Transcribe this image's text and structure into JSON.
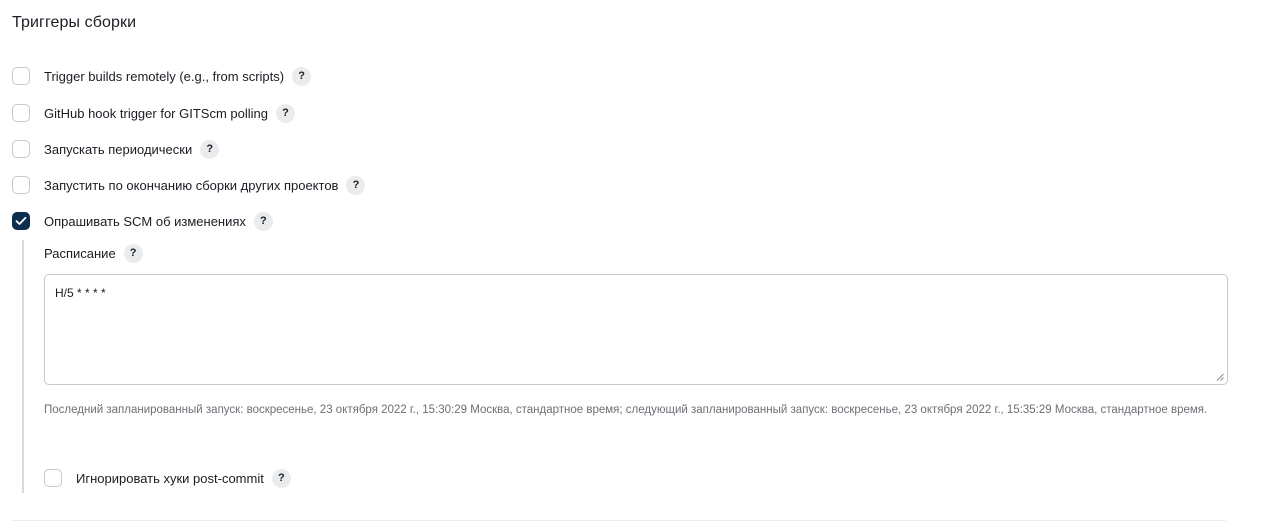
{
  "section": {
    "title": "Триггеры сборки"
  },
  "help_label": "?",
  "options": [
    {
      "label": "Trigger builds remotely (e.g., from scripts)",
      "checked": false
    },
    {
      "label": "GitHub hook trigger for GITScm polling",
      "checked": false
    },
    {
      "label": "Запускать периодически",
      "checked": false
    },
    {
      "label": "Запустить по окончанию сборки других проектов",
      "checked": false
    },
    {
      "label": "Опрашивать SCM об изменениях",
      "checked": true
    }
  ],
  "scm_polling": {
    "schedule_label": "Расписание",
    "schedule_value": "H/5 * * * *",
    "schedule_info": "Последний запланированный запуск: воскресенье, 23 октября 2022 г., 15:30:29 Москва, стандартное время; следующий запланированный запуск: воскресенье, 23 октября 2022 г., 15:35:29 Москва, стандартное время.",
    "ignore_hooks_label": "Игнорировать хуки post-commit",
    "ignore_hooks_checked": false
  },
  "colors": {
    "checkbox_checked": "#0d2f4d",
    "checkbox_border": "#c6c8ce",
    "help_bg": "#eaebed",
    "muted_text": "#6d6f75"
  },
  "icons": {
    "check": "check-icon",
    "help": "help-icon",
    "resize": "resize-grip-icon"
  }
}
